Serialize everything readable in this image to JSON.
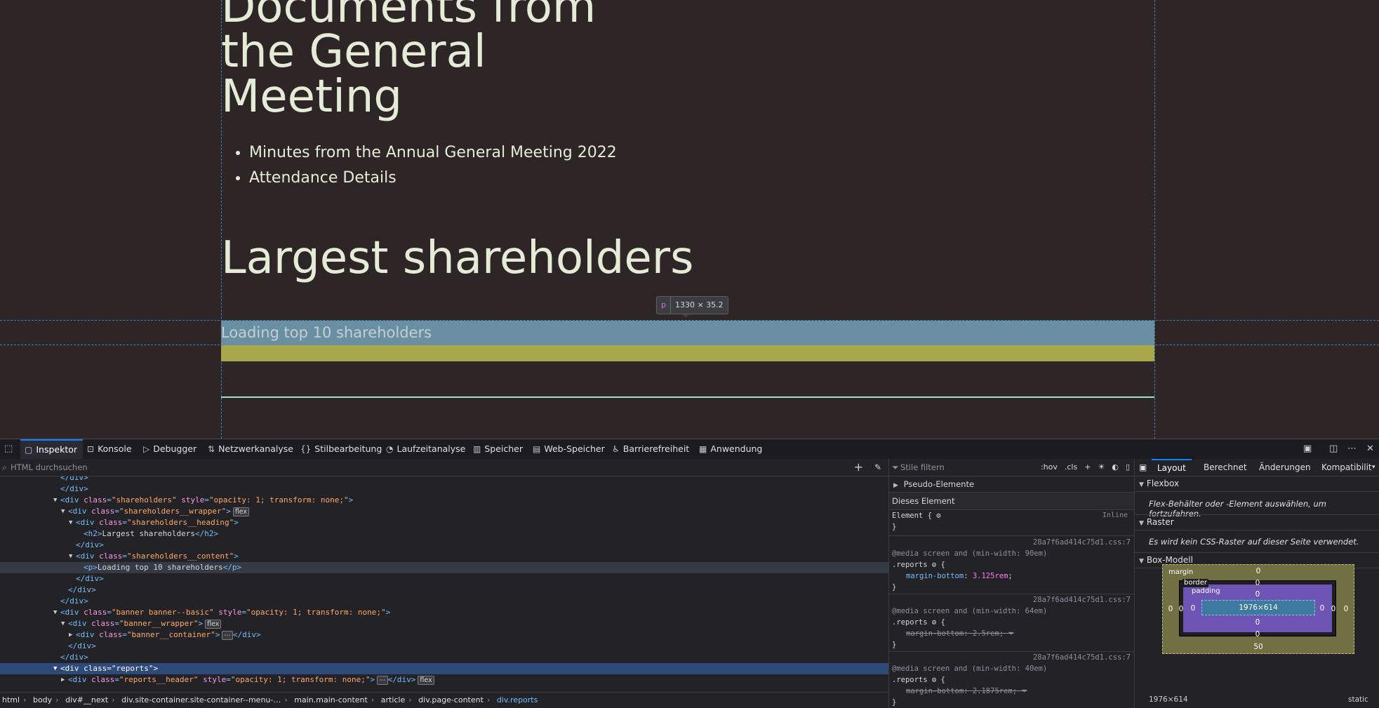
{
  "page": {
    "docs_title_lines": [
      "Documents from",
      "the General",
      "Meeting"
    ],
    "doc_links": [
      "Minutes from the Annual General Meeting 2022",
      "Attendance Details"
    ],
    "shareholders_title": "Largest shareholders",
    "loading_text": "Loading top 10 shareholders",
    "tooltip_tag": "p",
    "tooltip_size": "1330 × 35.2",
    "cut_text": "· · · · · · · · · · · ·"
  },
  "devtools": {
    "tabs": [
      {
        "label": "Inspektor",
        "icon": "inspector-icon",
        "active": true
      },
      {
        "label": "Konsole",
        "icon": "console-icon"
      },
      {
        "label": "Debugger",
        "icon": "debugger-icon"
      },
      {
        "label": "Netzwerkanalyse",
        "icon": "network-icon"
      },
      {
        "label": "Stilbearbeitung",
        "icon": "style-editor-icon"
      },
      {
        "label": "Laufzeitanalyse",
        "icon": "performance-icon"
      },
      {
        "label": "Speicher",
        "icon": "memory-icon"
      },
      {
        "label": "Web-Speicher",
        "icon": "storage-icon"
      },
      {
        "label": "Barrierefreiheit",
        "icon": "accessibility-icon"
      },
      {
        "label": "Anwendung",
        "icon": "application-icon"
      }
    ],
    "html_search_placeholder": "HTML durchsuchen",
    "markup": {
      "r0": "</div>",
      "r1": "</div>",
      "r2_tag": "div",
      "r2_class": "shareholders",
      "r2_style": "opacity: 1; transform: none;",
      "r3_class": "shareholders__wrapper",
      "r3_badge": "flex",
      "r4_class": "shareholders__heading",
      "r5_text": "Largest shareholders",
      "r6": "</div>",
      "r7_class": "shareholders__content",
      "r8_text": "Loading top 10 shareholders",
      "r9": "</div>",
      "r10": "</div>",
      "r11": "</div>",
      "r12_class": "banner banner--basic",
      "r12_style": "opacity: 1; transform: none;",
      "r13_class": "banner__wrapper",
      "r13_badge": "flex",
      "r14_class": "banner__container",
      "r14_dots": "⋯",
      "r15": "</div>",
      "r16": "</div>",
      "r17_class": "reports",
      "r18_class": "reports__header",
      "r18_style": "opacity: 1; transform: none;",
      "r18_dots": "⋯",
      "r18_badge": "flex"
    },
    "breadcrumbs": [
      "html",
      "body",
      "div#__next",
      "div.site-container.site-container--menu-…",
      "main.main-content",
      "article",
      "div.page-content",
      "div.reports"
    ],
    "styles": {
      "filter_placeholder": "Stile filtern",
      "hov": ":hov",
      "cls": ".cls",
      "pseudo": "Pseudo-Elemente",
      "this_element": "Dieses Element",
      "element_rule": "Element {",
      "inline": "Inline",
      "close": "}",
      "rules": [
        {
          "source": "28a7f6ad414c75d1.css:7",
          "media": "@media screen and (min-width: 90em)",
          "selector": ".reports",
          "prop": "margin-bottom",
          "value": "3.125rem",
          "overridden": false
        },
        {
          "source": "28a7f6ad414c75d1.css:7",
          "media": "@media screen and (min-width: 64em)",
          "selector": ".reports",
          "prop": "margin-bottom",
          "value": "2.5rem",
          "overridden": true
        },
        {
          "source": "28a7f6ad414c75d1.css:7",
          "media": "@media screen and (min-width: 40em)",
          "selector": ".reports",
          "prop": "margin-bottom",
          "value": "2.1875rem",
          "overridden": true
        }
      ]
    },
    "layout": {
      "tabs": [
        "Layout",
        "Berechnet",
        "Änderungen",
        "Kompatibilit"
      ],
      "flexbox_title": "Flexbox",
      "flexbox_note": "Flex-Behälter oder -Element auswählen, um fortzufahren.",
      "grid_title": "Raster",
      "grid_note": "Es wird kein CSS-Raster auf dieser Seite verwendet.",
      "boxmodel_title": "Box-Modell",
      "box": {
        "margin_label": "margin",
        "border_label": "border",
        "padding_label": "padding",
        "content": "1976×614",
        "margin_top": "0",
        "margin_right": "0",
        "margin_bottom": "50",
        "margin_left": "0",
        "border_top": "0",
        "border_right": "0",
        "border_bottom": "0",
        "border_left": "0",
        "padding_top": "0",
        "padding_right": "0",
        "padding_bottom": "0",
        "padding_left": "0"
      },
      "footer_size": "1976×614",
      "footer_position": "static"
    }
  }
}
